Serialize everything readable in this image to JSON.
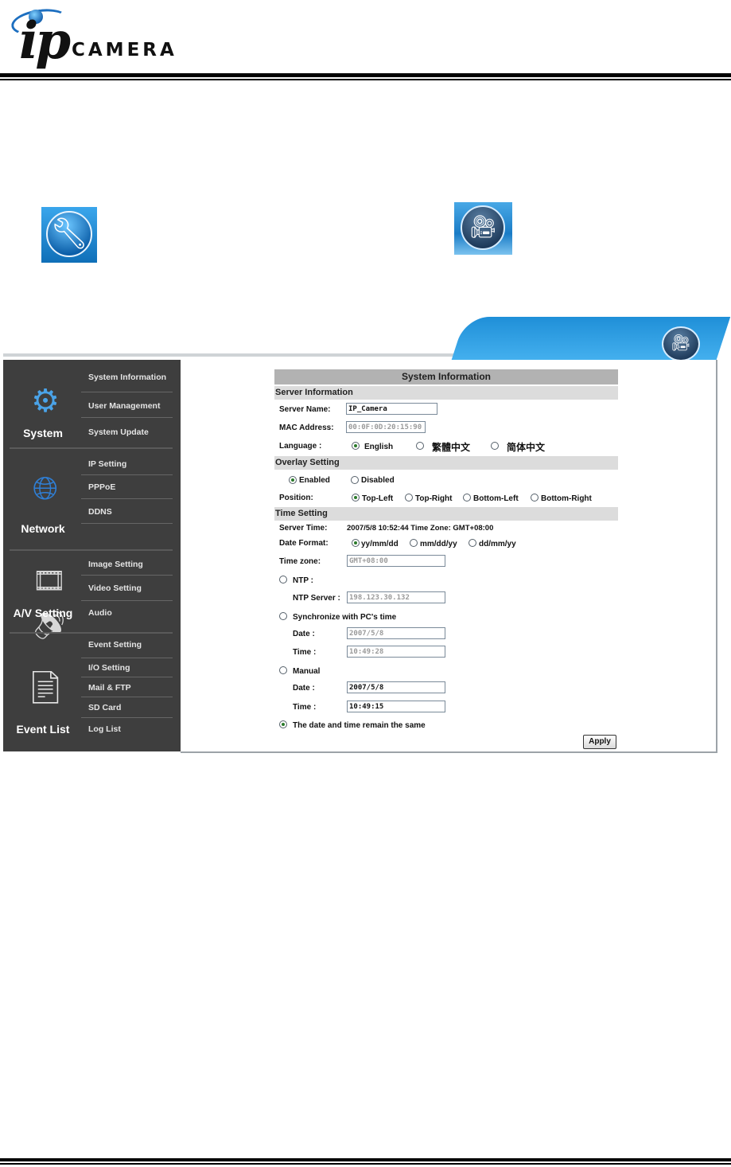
{
  "header": {
    "logo_ip": "ip",
    "logo_text": "CAMERA"
  },
  "icons": {
    "tool": "wrench-icon",
    "camera": "video-camera-icon"
  },
  "sidebar": {
    "groups": [
      {
        "name": "System",
        "icon": "gears-icon",
        "items": [
          "System Information",
          "User Management",
          "System Update"
        ]
      },
      {
        "name": "Network",
        "icon": "globe-icon",
        "items": [
          "IP Setting",
          "PPPoE",
          "DDNS"
        ]
      },
      {
        "name": "A/V Setting",
        "icon": "film-speaker-icon",
        "items": [
          "Image Setting",
          "Video Setting",
          "Audio"
        ]
      },
      {
        "name": "Event List",
        "icon": "document-list-icon",
        "items": [
          "Event Setting",
          "I/O Setting",
          "Mail & FTP",
          "SD Card",
          "Log List"
        ]
      }
    ]
  },
  "panel": {
    "title": "System Information",
    "server_info": {
      "header": "Server Information",
      "server_name_label": "Server Name:",
      "server_name_value": "IP_Camera",
      "mac_label": "MAC Address:",
      "mac_value": "00:0F:0D:20:15:90",
      "language_label": "Language :",
      "languages": [
        "English",
        "繁體中文",
        "简体中文"
      ],
      "language_selected": "English"
    },
    "overlay": {
      "header": "Overlay Setting",
      "enabled_label": "Enabled",
      "disabled_label": "Disabled",
      "selected": "Enabled",
      "position_label": "Position:",
      "positions": [
        "Top-Left",
        "Top-Right",
        "Bottom-Left",
        "Bottom-Right"
      ],
      "position_selected": "Top-Left"
    },
    "time": {
      "header": "Time Setting",
      "server_time_label": "Server Time:",
      "server_time_value": "2007/5/8 10:52:44 Time Zone: GMT+08:00",
      "date_format_label": "Date Format:",
      "date_formats": [
        "yy/mm/dd",
        "mm/dd/yy",
        "dd/mm/yy"
      ],
      "date_format_selected": "yy/mm/dd",
      "timezone_label": "Time zone:",
      "timezone_value": "GMT+08:00",
      "ntp_label": "NTP :",
      "ntp_server_label": "NTP Server :",
      "ntp_server_value": "198.123.30.132",
      "sync_label": "Synchronize with PC's time",
      "sync_date_label": "Date :",
      "sync_date_value": "2007/5/8",
      "sync_time_label": "Time :",
      "sync_time_value": "10:49:28",
      "manual_label": "Manual",
      "manual_date_label": "Date :",
      "manual_date_value": "2007/5/8",
      "manual_time_label": "Time :",
      "manual_time_value": "10:49:15",
      "remain_label": "The date and time remain the same",
      "mode_selected": "The date and time remain the same"
    },
    "apply_label": "Apply"
  }
}
